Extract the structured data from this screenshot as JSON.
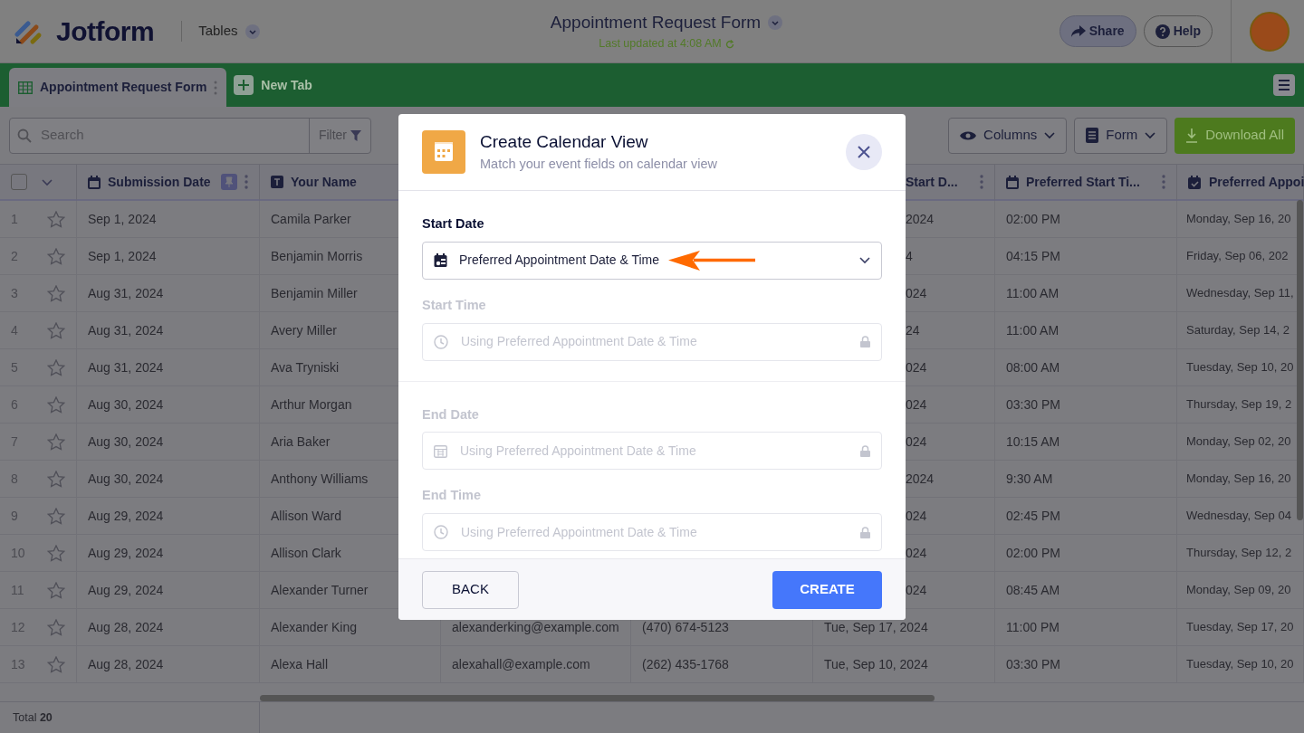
{
  "header": {
    "logo": "Jotform",
    "app_menu": "Tables",
    "title": "Appointment Request Form",
    "last_updated": "Last updated at 4:08 AM",
    "share": "Share",
    "help": "Help"
  },
  "tabs": [
    {
      "label": "Appointment Request Form",
      "selected": true
    }
  ],
  "new_tab": "New Tab",
  "toolbar": {
    "search_placeholder": "Search",
    "filter": "Filter",
    "columns": "Columns",
    "form": "Form",
    "download": "Download All"
  },
  "table": {
    "select_all_checked": false,
    "columns": [
      {
        "label": "Submission Date"
      },
      {
        "label": "Your Name"
      },
      {},
      {},
      {
        "label": "Start D..."
      },
      {
        "label": "Preferred Start Ti..."
      },
      {
        "label": "Preferred Appoi"
      }
    ],
    "rows": [
      {
        "num": "1",
        "starred": false,
        "cells": [
          "Sep 1, 2024",
          "Camila Parker",
          null,
          null,
          "2024",
          "02:00 PM",
          "Monday, Sep 16, 20"
        ]
      },
      {
        "num": "2",
        "starred": false,
        "cells": [
          "Sep 1, 2024",
          "Benjamin Morris",
          null,
          null,
          "4",
          "04:15 PM",
          "Friday, Sep 06, 202"
        ]
      },
      {
        "num": "3",
        "starred": false,
        "cells": [
          "Aug 31, 2024",
          "Benjamin Miller",
          null,
          null,
          "024",
          "11:00 AM",
          "Wednesday, Sep 11,"
        ]
      },
      {
        "num": "4",
        "starred": false,
        "cells": [
          "Aug 31, 2024",
          "Avery Miller",
          null,
          null,
          "24",
          "11:00 AM",
          "Saturday, Sep 14, 2"
        ]
      },
      {
        "num": "5",
        "starred": false,
        "cells": [
          "Aug 31, 2024",
          "Ava Tryniski",
          null,
          null,
          "024",
          "08:00 AM",
          "Tuesday, Sep 10, 20"
        ]
      },
      {
        "num": "6",
        "starred": false,
        "cells": [
          "Aug 30, 2024",
          "Arthur Morgan",
          null,
          null,
          "024",
          "03:30 PM",
          "Thursday, Sep 19, 2"
        ]
      },
      {
        "num": "7",
        "starred": false,
        "cells": [
          "Aug 30, 2024",
          "Aria Baker",
          null,
          null,
          "024",
          "10:15 AM",
          "Monday, Sep 02, 20"
        ]
      },
      {
        "num": "8",
        "starred": false,
        "cells": [
          "Aug 30, 2024",
          "Anthony Williams",
          null,
          null,
          "2024",
          "9:30 AM",
          "Monday, Sep 16, 20"
        ]
      },
      {
        "num": "9",
        "starred": false,
        "cells": [
          "Aug 29, 2024",
          "Allison Ward",
          null,
          null,
          "024",
          "02:45 PM",
          "Wednesday, Sep 04"
        ]
      },
      {
        "num": "10",
        "starred": false,
        "cells": [
          "Aug 29, 2024",
          "Allison Clark",
          null,
          null,
          "024",
          "02:00 PM",
          "Thursday, Sep 12, 2"
        ]
      },
      {
        "num": "11",
        "starred": false,
        "cells": [
          "Aug 29, 2024",
          "Alexander Turner",
          null,
          null,
          "024",
          "08:45 AM",
          "Monday, Sep 09, 20"
        ]
      },
      {
        "num": "12",
        "starred": false,
        "cells": [
          "Aug 28, 2024",
          "Alexander King",
          "alexanderking@example.com",
          "(470) 674-5123",
          "Tue, Sep 17, 2024",
          "11:00 PM",
          "Tuesday, Sep 17, 20"
        ]
      },
      {
        "num": "13",
        "starred": false,
        "cells": [
          "Aug 28, 2024",
          "Alexa Hall",
          "alexahall@example.com",
          "(262) 435-1768",
          "Tue, Sep 10, 2024",
          "03:30 PM",
          "Tuesday, Sep 10, 20"
        ]
      }
    ],
    "total": "Total **20**"
  },
  "modal": {
    "title": "Create Calendar View",
    "subtitle": "Match your event fields on calendar view",
    "fields": [
      {
        "label": "Start Date",
        "value": "Preferred Appointment Date & Time",
        "disabled": false
      },
      {
        "label": "Start Time",
        "placeholder": "Using Preferred Appointment Date & Time",
        "disabled": true
      },
      {
        "label": "End Date",
        "placeholder": "Using Preferred Appointment Date & Time",
        "disabled": true
      },
      {
        "label": "End Time",
        "placeholder": "Using Preferred Appointment Date & Time",
        "disabled": true
      }
    ],
    "back": "BACK",
    "create": "CREATE"
  }
}
